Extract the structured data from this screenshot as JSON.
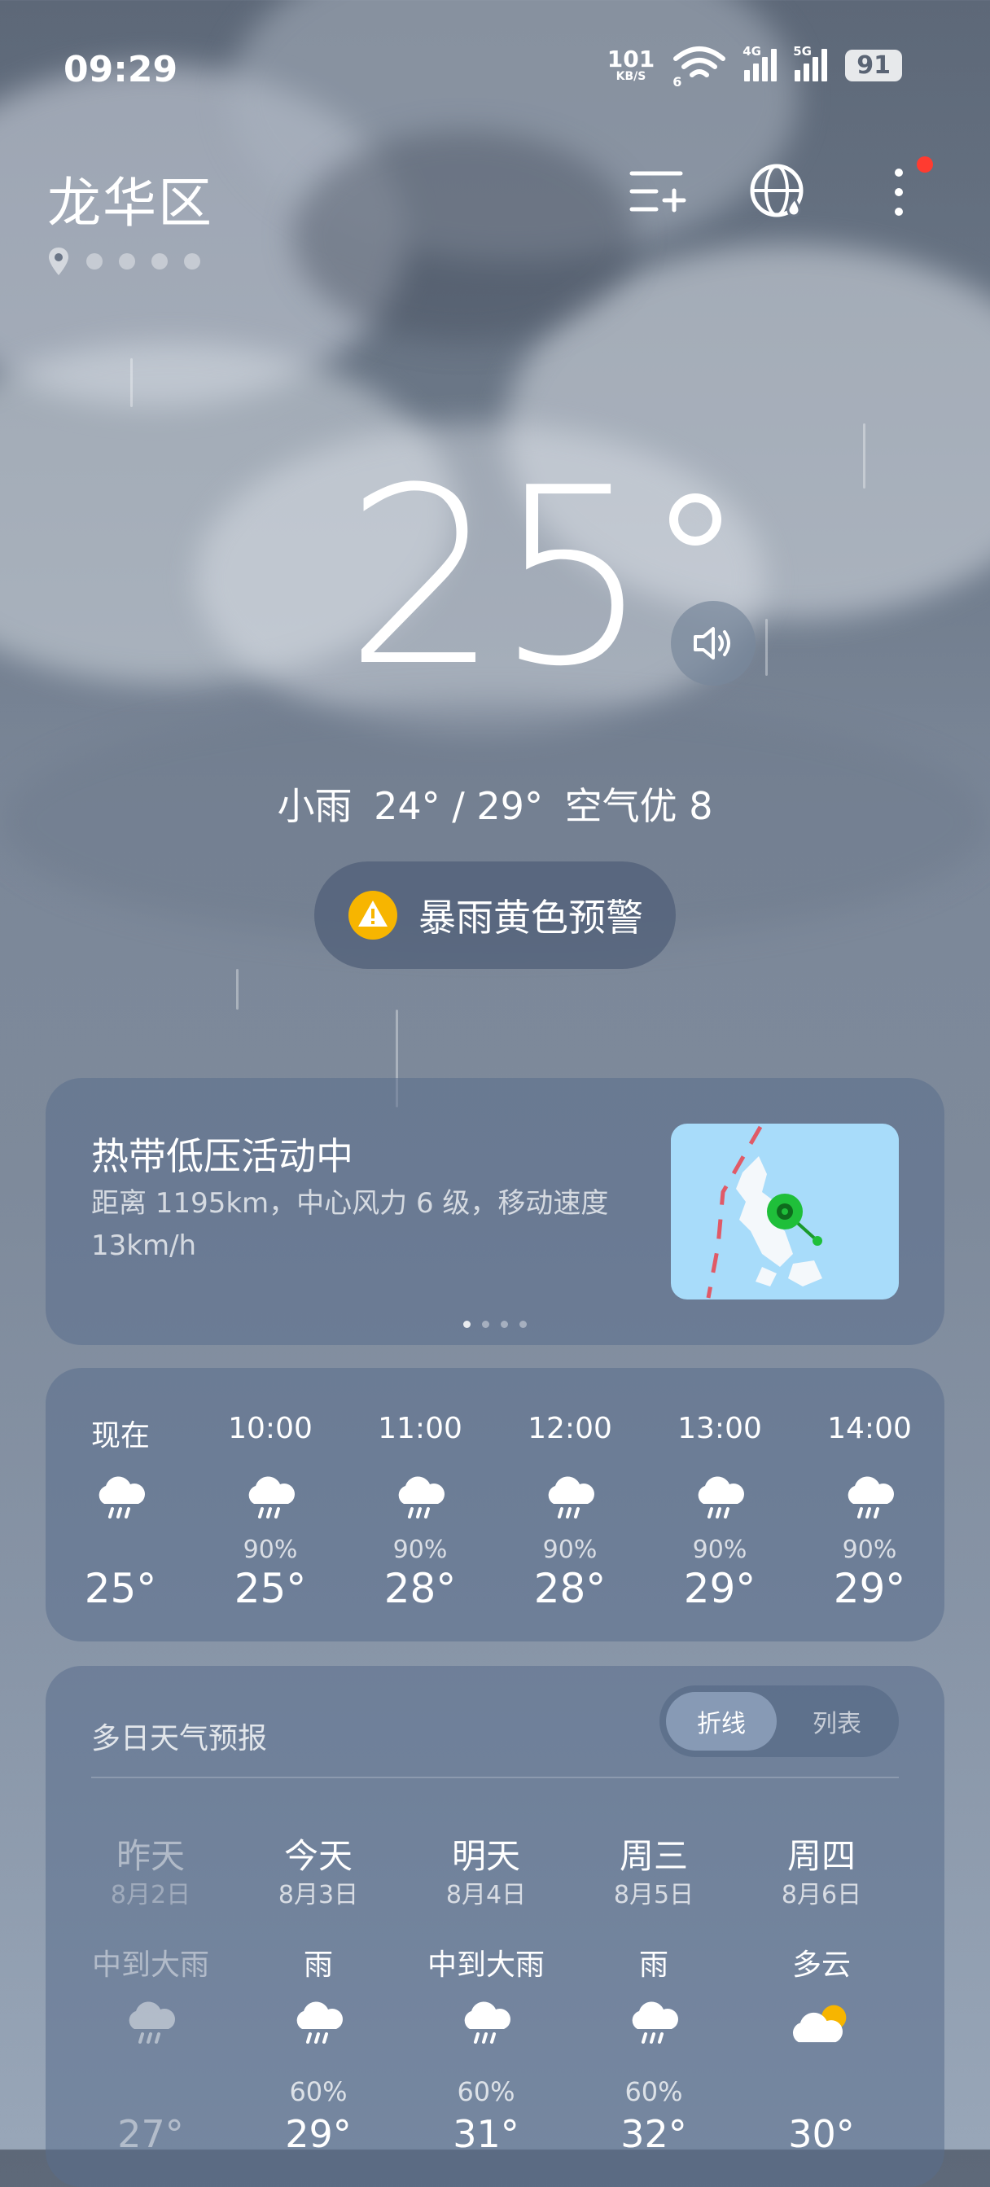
{
  "status_bar": {
    "time": "09:29",
    "net_speed": "101",
    "net_unit": "KB/S",
    "wifi_badge": "6",
    "sim1": "4G",
    "sim2": "5G",
    "battery": "91"
  },
  "header": {
    "city": "龙华区",
    "icons": [
      "add-city-icon",
      "globe-icon",
      "more-icon"
    ]
  },
  "current": {
    "temp": "25",
    "condition": "小雨",
    "range": "24° / 29°",
    "air": "空气优 8"
  },
  "alert": {
    "label": "暴雨黄色预警",
    "color": "#f7b500"
  },
  "typhoon": {
    "title": "热带低压活动中",
    "desc": "距离 1195km，中心风力 6 级，移动速度 13km/h"
  },
  "hourly": [
    {
      "time": "现在",
      "precip": "",
      "temp": "25°"
    },
    {
      "time": "10:00",
      "precip": "90%",
      "temp": "25°"
    },
    {
      "time": "11:00",
      "precip": "90%",
      "temp": "28°"
    },
    {
      "time": "12:00",
      "precip": "90%",
      "temp": "28°"
    },
    {
      "time": "13:00",
      "precip": "90%",
      "temp": "29°"
    },
    {
      "time": "14:00",
      "precip": "90%",
      "temp": "29°"
    }
  ],
  "forecast": {
    "title": "多日天气预报",
    "toggle": {
      "active": "折线",
      "inactive": "列表"
    },
    "days": [
      {
        "day": "昨天",
        "date": "8月2日",
        "weather": "中到大雨",
        "precip": "",
        "high": "27°",
        "icon": "rain-icon"
      },
      {
        "day": "今天",
        "date": "8月3日",
        "weather": "雨",
        "precip": "60%",
        "high": "29°",
        "icon": "rain-icon"
      },
      {
        "day": "明天",
        "date": "8月4日",
        "weather": "中到大雨",
        "precip": "60%",
        "high": "31°",
        "icon": "rain-icon"
      },
      {
        "day": "周三",
        "date": "8月5日",
        "weather": "雨",
        "precip": "60%",
        "high": "32°",
        "icon": "rain-icon"
      },
      {
        "day": "周四",
        "date": "8月6日",
        "weather": "多云",
        "precip": "",
        "high": "30°",
        "icon": "partly-cloudy-icon"
      }
    ]
  }
}
